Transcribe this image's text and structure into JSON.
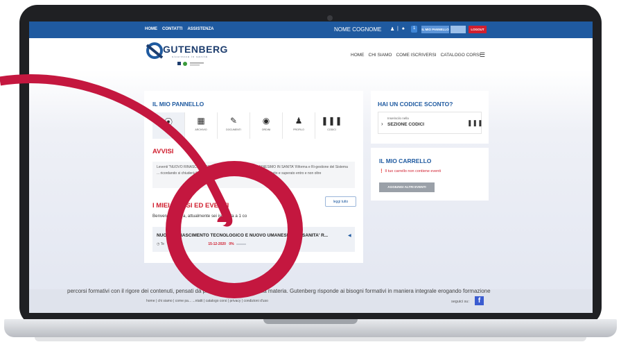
{
  "topbar": {
    "links": [
      "HOME",
      "CONTATTI",
      "ASSISTENZA"
    ],
    "username": "NOME COGNOME",
    "badge_count": "1",
    "panel_button": "IL MIO PANNELLO",
    "logout_button": "LOGOUT"
  },
  "header": {
    "logo_text": "GUTENBERG",
    "logo_tagline": "sicurezza in sanità",
    "nav": [
      "HOME",
      "CHI SIAMO",
      "COME ISCRIVERSI",
      "CATALOGO CORSI"
    ]
  },
  "panel": {
    "title": "IL MIO PANNELLO",
    "items": [
      {
        "label": "HOME",
        "icon": "home-icon"
      },
      {
        "label": "ARCHIVIO",
        "icon": "archive-icon"
      },
      {
        "label": "DOCUMENTI",
        "icon": "documents-icon"
      },
      {
        "label": "ORDINI",
        "icon": "orders-icon"
      },
      {
        "label": "PROFILO",
        "icon": "profile-icon"
      },
      {
        "label": "CODICI",
        "icon": "barcode-icon"
      }
    ]
  },
  "avvisi": {
    "title": "AVVISI",
    "text": "Leventi \"NUOVO RINASCIMENTO TECNOLOGICO E NUOVO UMANESIMO IN SANITA' Riforma e Ri-gestione del Sistema ... ricordando si chiuderà il 15/12/2020. Il test di valutazione ... essere sostituito e superato entro e non oltre"
  },
  "eventi": {
    "button": "leggi tutto",
    "title": "I MIEI CORSI ED EVENTI",
    "welcome": "Benvenuto Prova, attualmente sei iscritto/a a 1 co",
    "event_title": "NUOVO RINASCIMENTO TECNOLOGICO E NUOVO UMANESIMO IN SANITA' R...",
    "event_meta_prefix": "Te",
    "event_date": "15-12-2020",
    "event_percent": "0%"
  },
  "codice": {
    "title": "HAI UN CODICE SCONTO?",
    "small": "Inseriscilo nella",
    "label": "SEZIONE CODICI"
  },
  "carrello": {
    "title": "IL MIO CARRELLO",
    "message": "Il tuo carrello non contiene eventi",
    "button": "AGGIUNGI ALTRI EVENTI"
  },
  "footer": {
    "links": "home | chi siamo | come pa... ...ntatti | catalogo corsi | privacy | condizioni d'uso",
    "follow": "seguici su:",
    "marquee": "percorsi formativi con il rigore dei contenuti, pensati da professionisti esperti della materia. Gutenberg risponde ai bisogni formativi in maniera integrale erogando formazione"
  },
  "colors": {
    "brand_blue": "#1f5aa0",
    "accent_red": "#d01f2f",
    "overlay_red": "#c4173f"
  }
}
